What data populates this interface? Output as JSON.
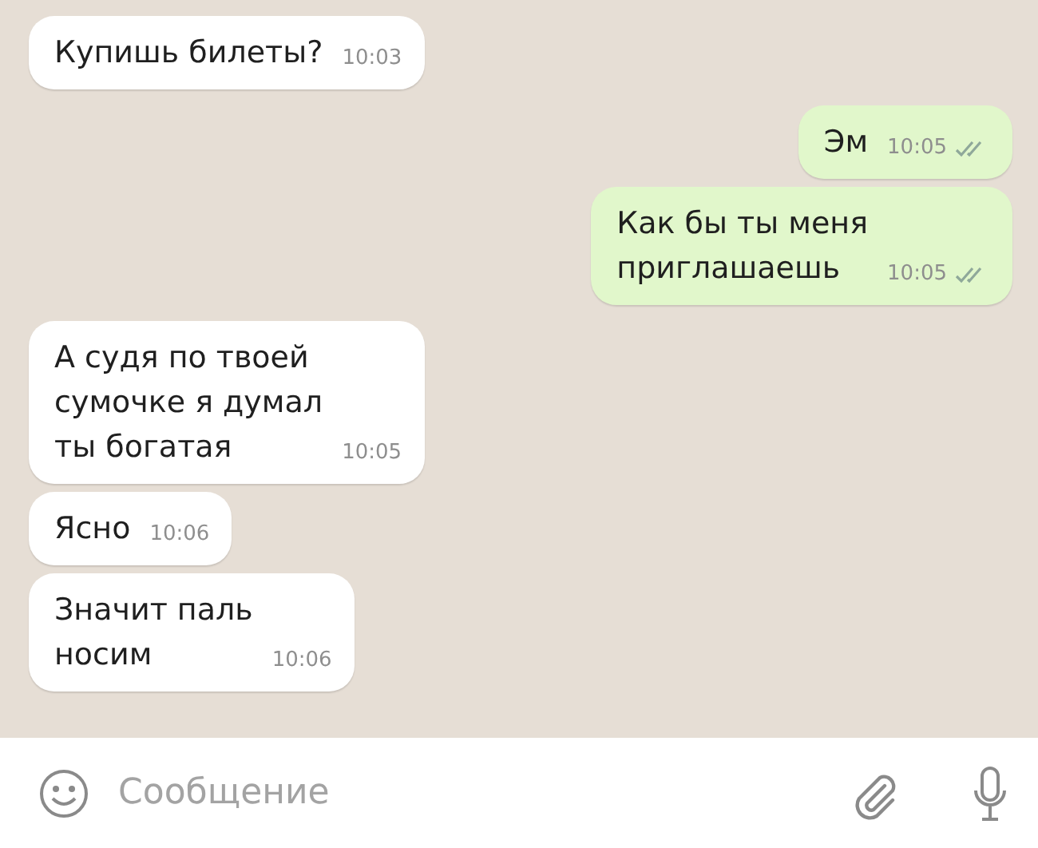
{
  "messages": [
    {
      "kind": "incoming",
      "text": "Купишь билеты?",
      "time": "10:03"
    },
    {
      "kind": "outgoing",
      "text": "Эм",
      "time": "10:05",
      "read": false
    },
    {
      "kind": "outgoing",
      "text": "Как бы ты меня\nприглашаешь",
      "time": "10:05",
      "read": false
    },
    {
      "kind": "incoming",
      "text": "А судя по твоей\nсумочке я думал\nты богатая",
      "time": "10:05"
    },
    {
      "kind": "incoming",
      "text": "Ясно",
      "time": "10:06"
    },
    {
      "kind": "incoming",
      "text": "Значит паль\nносим",
      "time": "10:06"
    }
  ],
  "composer": {
    "placeholder": "Сообщение"
  }
}
